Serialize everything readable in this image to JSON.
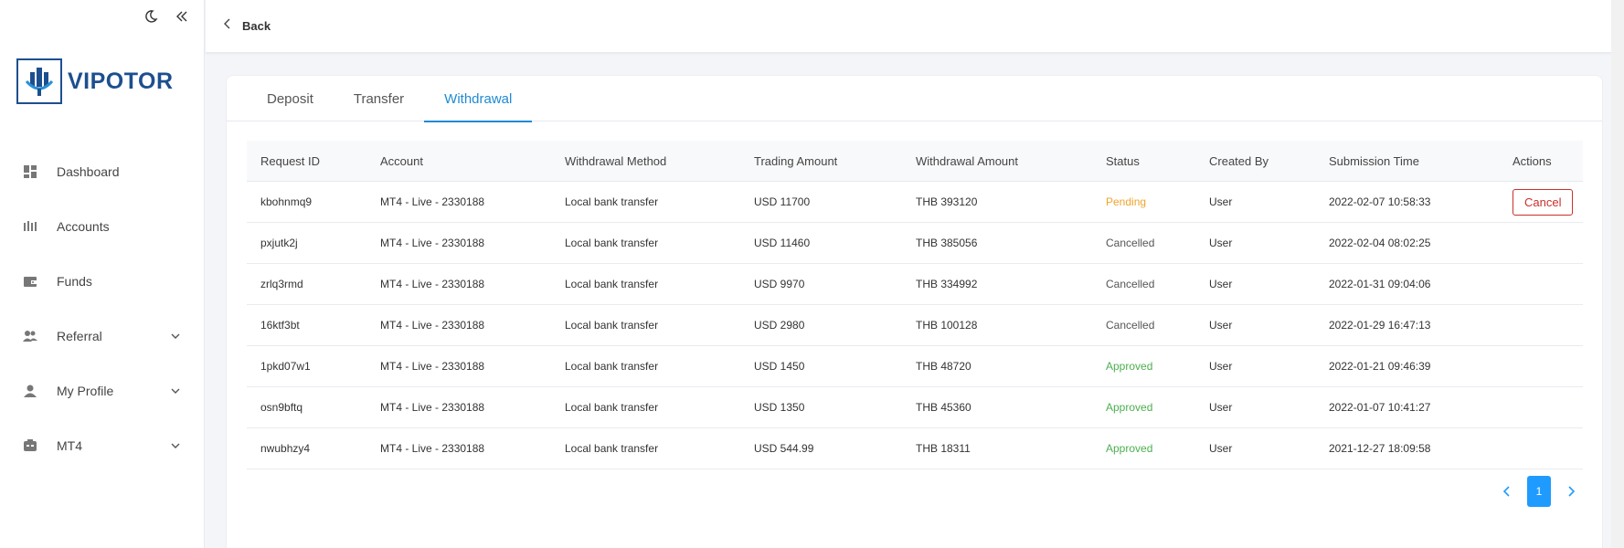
{
  "app": {
    "brand": "VIPOTOR"
  },
  "topbar": {
    "back_label": "Back"
  },
  "sidebar": {
    "items": [
      {
        "label": "Dashboard",
        "icon": "dashboard-icon",
        "has_children": false
      },
      {
        "label": "Accounts",
        "icon": "accounts-icon",
        "has_children": false
      },
      {
        "label": "Funds",
        "icon": "funds-icon",
        "has_children": false
      },
      {
        "label": "Referral",
        "icon": "referral-icon",
        "has_children": true
      },
      {
        "label": "My Profile",
        "icon": "user-icon",
        "has_children": true
      },
      {
        "label": "MT4",
        "icon": "mt4-icon",
        "has_children": true
      }
    ]
  },
  "tabs": [
    {
      "label": "Deposit",
      "active": false
    },
    {
      "label": "Transfer",
      "active": false
    },
    {
      "label": "Withdrawal",
      "active": true
    }
  ],
  "table": {
    "headers": [
      "Request ID",
      "Account",
      "Withdrawal Method",
      "Trading Amount",
      "Withdrawal Amount",
      "Status",
      "Created By",
      "Submission Time",
      "Actions"
    ],
    "rows": [
      {
        "id": "kbohnmq9",
        "account": "MT4 - Live - 2330188",
        "method": "Local bank transfer",
        "trading": "USD 11700",
        "withdrawal": "THB 393120",
        "status": "Pending",
        "created_by": "User",
        "time": "2022-02-07 10:58:33",
        "action": "Cancel"
      },
      {
        "id": "pxjutk2j",
        "account": "MT4 - Live - 2330188",
        "method": "Local bank transfer",
        "trading": "USD 11460",
        "withdrawal": "THB 385056",
        "status": "Cancelled",
        "created_by": "User",
        "time": "2022-02-04 08:02:25",
        "action": ""
      },
      {
        "id": "zrlq3rmd",
        "account": "MT4 - Live - 2330188",
        "method": "Local bank transfer",
        "trading": "USD 9970",
        "withdrawal": "THB 334992",
        "status": "Cancelled",
        "created_by": "User",
        "time": "2022-01-31 09:04:06",
        "action": ""
      },
      {
        "id": "16ktf3bt",
        "account": "MT4 - Live - 2330188",
        "method": "Local bank transfer",
        "trading": "USD 2980",
        "withdrawal": "THB 100128",
        "status": "Cancelled",
        "created_by": "User",
        "time": "2022-01-29 16:47:13",
        "action": ""
      },
      {
        "id": "1pkd07w1",
        "account": "MT4 - Live - 2330188",
        "method": "Local bank transfer",
        "trading": "USD 1450",
        "withdrawal": "THB 48720",
        "status": "Approved",
        "created_by": "User",
        "time": "2022-01-21 09:46:39",
        "action": ""
      },
      {
        "id": "osn9bftq",
        "account": "MT4 - Live - 2330188",
        "method": "Local bank transfer",
        "trading": "USD 1350",
        "withdrawal": "THB 45360",
        "status": "Approved",
        "created_by": "User",
        "time": "2022-01-07 10:41:27",
        "action": ""
      },
      {
        "id": "nwubhzy4",
        "account": "MT4 - Live - 2330188",
        "method": "Local bank transfer",
        "trading": "USD 544.99",
        "withdrawal": "THB 18311",
        "status": "Approved",
        "created_by": "User",
        "time": "2021-12-27 18:09:58",
        "action": ""
      }
    ]
  },
  "pagination": {
    "current": "1"
  },
  "colors": {
    "accent": "#1f8ad3",
    "pending": "#f0a42a",
    "approved": "#4caf50",
    "danger": "#c9302c",
    "brand": "#1d4f8f"
  }
}
